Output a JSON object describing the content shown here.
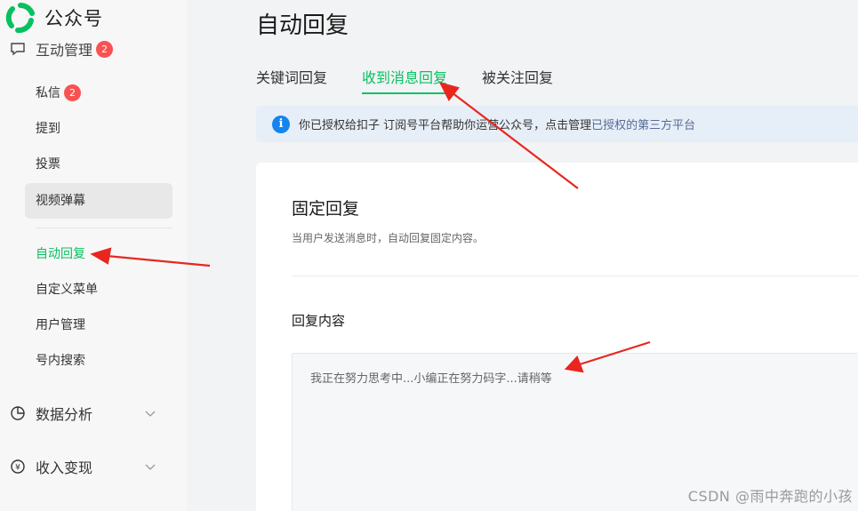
{
  "app": {
    "name": "公众号"
  },
  "sidebar": {
    "clipped_group": {
      "label": "互动管理",
      "badge": "2"
    },
    "items": [
      {
        "label": "私信",
        "badge": "2"
      },
      {
        "label": "提到"
      },
      {
        "label": "投票"
      },
      {
        "label": "视频弹幕"
      },
      {
        "label": "自动回复"
      },
      {
        "label": "自定义菜单"
      },
      {
        "label": "用户管理"
      },
      {
        "label": "号内搜索"
      }
    ],
    "groups": [
      {
        "label": "数据分析"
      },
      {
        "label": "收入变现",
        "icon_glyph": "¥"
      }
    ]
  },
  "main": {
    "title": "自动回复",
    "tabs": [
      "关键词回复",
      "收到消息回复",
      "被关注回复"
    ],
    "active_tab": "收到消息回复",
    "notice": {
      "text": "你已授权给扣子 订阅号平台帮助你运营公众号，点击管理",
      "link": "已授权的第三方平台"
    },
    "section": {
      "title": "固定回复",
      "description": "当用户发送消息时，自动回复固定内容。",
      "field_label": "回复内容",
      "reply_text": "我正在努力思考中...小编正在努力码字...请稍等"
    }
  },
  "watermark": "CSDN @雨中奔跑的小孩",
  "colors": {
    "accent": "#07c160",
    "badge": "#fa5151",
    "info": "#1485ee",
    "link": "#576b95",
    "arrow": "#e8261e"
  }
}
